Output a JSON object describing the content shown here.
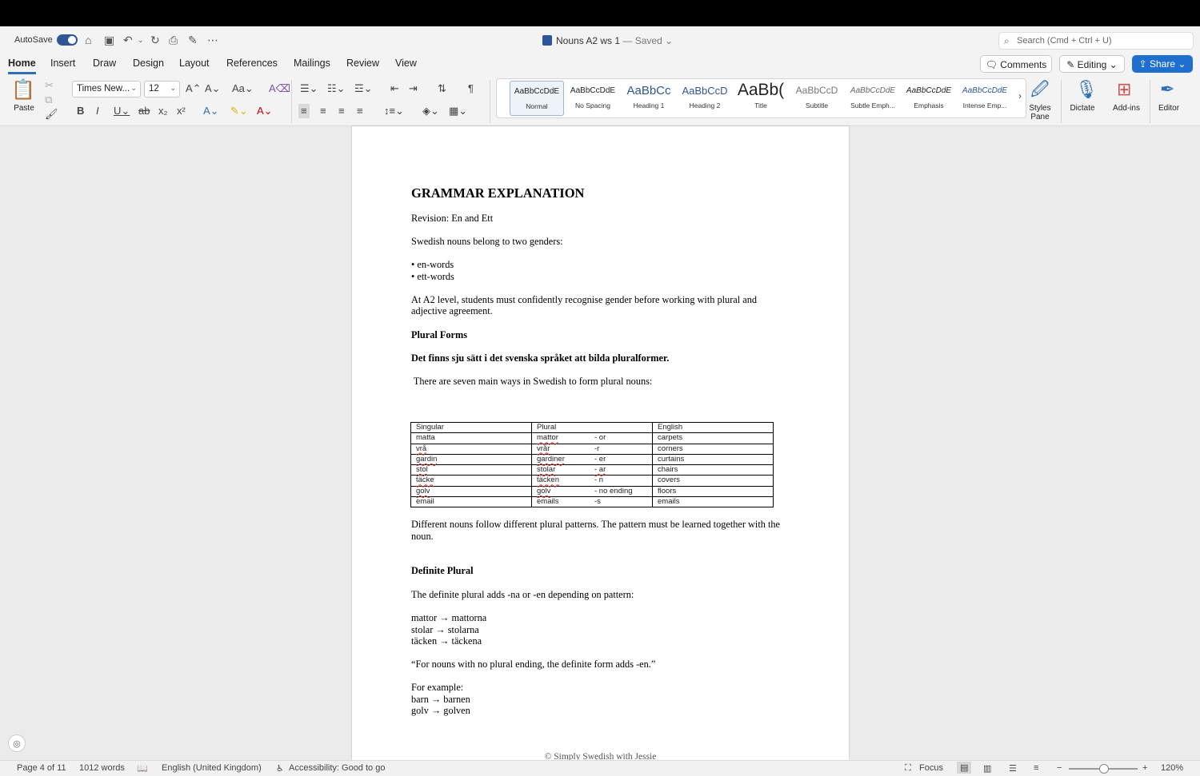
{
  "titlebar": {
    "autosave_label": "AutoSave",
    "doc_name": "Nouns A2 ws 1",
    "saved_status": "— Saved",
    "search_placeholder": "Search (Cmd + Ctrl + U)"
  },
  "tabs": [
    "Home",
    "Insert",
    "Draw",
    "Design",
    "Layout",
    "References",
    "Mailings",
    "Review",
    "View"
  ],
  "actions": {
    "comments": "Comments",
    "editing": "Editing",
    "share": "Share"
  },
  "ribbon": {
    "paste": "Paste",
    "font_name": "Times New...",
    "font_size": "12",
    "styles": [
      {
        "sample": "AaBbCcDdE",
        "name": "Normal"
      },
      {
        "sample": "AaBbCcDdE",
        "name": "No Spacing"
      },
      {
        "sample": "AaBbCc",
        "name": "Heading 1"
      },
      {
        "sample": "AaBbCcD",
        "name": "Heading 2"
      },
      {
        "sample": "AaBb(",
        "name": "Title"
      },
      {
        "sample": "AaBbCcD",
        "name": "Subtitle"
      },
      {
        "sample": "AaBbCcDdE",
        "name": "Subtle Emph..."
      },
      {
        "sample": "AaBbCcDdE",
        "name": "Emphasis"
      },
      {
        "sample": "AaBbCcDdE",
        "name": "Intense Emp..."
      }
    ],
    "styles_pane": "Styles Pane",
    "dictate": "Dictate",
    "addins": "Add-ins",
    "editor": "Editor"
  },
  "document": {
    "heading": "GRAMMAR EXPLANATION",
    "revision": "Revision: En and Ett",
    "genders_intro": "Swedish nouns belong to two genders:",
    "bullet_en": "• en-words",
    "bullet_ett": "• ett-words",
    "a2_line1": "At A2 level, students must confidently recognise gender before working with plural and",
    "a2_line2": "adjective agreement.",
    "plural_forms": "Plural Forms",
    "swedish_line": "Det finns sju sätt i det svenska språket att bilda pluralformer.",
    "seven_ways": " There are seven main ways in Swedish to form plural nouns:",
    "table": {
      "headers": [
        "Singular",
        "Plural",
        "English"
      ],
      "rows": [
        {
          "singular": "matta",
          "plural": "mattor",
          "suffix": "- or",
          "english": "carpets"
        },
        {
          "singular": "vrå",
          "plural": "vrår",
          "suffix": "-r",
          "english": "corners"
        },
        {
          "singular": "gardin",
          "plural": "gardiner",
          "suffix": "- er",
          "english": "curtains"
        },
        {
          "singular": "stol",
          "plural": "stolar",
          "suffix": "- ar",
          "english": "chairs"
        },
        {
          "singular": "täcke",
          "plural": "täcken",
          "suffix": "- n",
          "english": "covers"
        },
        {
          "singular": "golv",
          "plural": "golv",
          "suffix": "- no ending",
          "english": "floors"
        },
        {
          "singular": "email",
          "plural": "emails",
          "suffix": "-s",
          "english": "emails"
        }
      ]
    },
    "patterns_line1": "Different nouns follow different plural patterns. The pattern must be learned together with the",
    "patterns_line2": "noun.",
    "definite_plural": "Definite Plural",
    "definite_intro": "The definite plural adds -na or -en depending on pattern:",
    "ex1": "mattor → mattorna",
    "ex2": "stolar → stolarna",
    "ex3": "täcken → täckena",
    "quote": "“For nouns with no plural ending, the definite form adds -en.”",
    "for_example": "For example:",
    "ex4": "barn → barnen",
    "ex5": "golv → golven",
    "footer": "© Simply Swedish with Jessie"
  },
  "status": {
    "page": "Page 4 of 11",
    "words": "1012 words",
    "language": "English (United Kingdom)",
    "accessibility": "Accessibility: Good to go",
    "focus": "Focus",
    "zoom": "120%",
    "zoom_level_percent": 120
  },
  "colors": {
    "accent": "#2f6fb5",
    "share": "#1f6fd1",
    "toggle": "#2f5597"
  }
}
